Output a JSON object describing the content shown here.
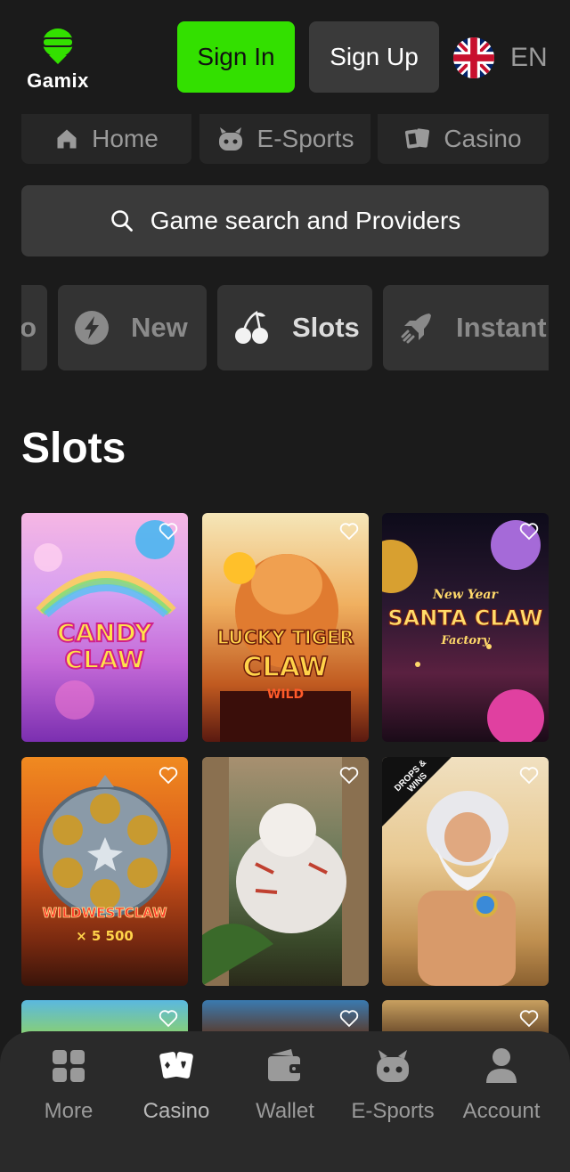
{
  "header": {
    "logo_text": "Gamix",
    "sign_in": "Sign In",
    "sign_up": "Sign Up",
    "language": "EN"
  },
  "topnav": [
    {
      "label": "Home",
      "icon": "home-icon"
    },
    {
      "label": "E-Sports",
      "icon": "gamepad-icon"
    },
    {
      "label": "Casino",
      "icon": "cards-icon"
    }
  ],
  "search": {
    "label": "Game search and Providers",
    "icon": "search-icon"
  },
  "chips": [
    {
      "label": "o",
      "icon": ""
    },
    {
      "label": "New",
      "icon": "lightning-icon"
    },
    {
      "label": "Slots",
      "icon": "cherries-icon"
    },
    {
      "label": "Instant",
      "icon": "rocket-icon"
    }
  ],
  "section_title": "Slots",
  "games": [
    {
      "title_line1": "CANDY",
      "title_line2": "CLAW"
    },
    {
      "title_line1": "LUCKY TIGER",
      "title_line2": "CLAW",
      "tag": "WILD"
    },
    {
      "title_line1": "New Year",
      "title_line2": "SANTA CLAW",
      "subtitle": "Factory"
    },
    {
      "title_line1": "WILDWESTCLAW",
      "title_line2": "× 5 500"
    },
    {
      "title_line1": "",
      "title_line2": ""
    },
    {
      "title_line1": "",
      "title_line2": "",
      "badge": "DROPS & WINS"
    }
  ],
  "bottomnav": [
    {
      "label": "More",
      "icon": "grid-icon"
    },
    {
      "label": "Casino",
      "icon": "cards-icon"
    },
    {
      "label": "Wallet",
      "icon": "wallet-icon"
    },
    {
      "label": "E-Sports",
      "icon": "gamepad-icon"
    },
    {
      "label": "Account",
      "icon": "user-icon"
    }
  ],
  "colors": {
    "accent": "#33e000",
    "background": "#1b1b1b",
    "surface": "#3a3a3a"
  }
}
